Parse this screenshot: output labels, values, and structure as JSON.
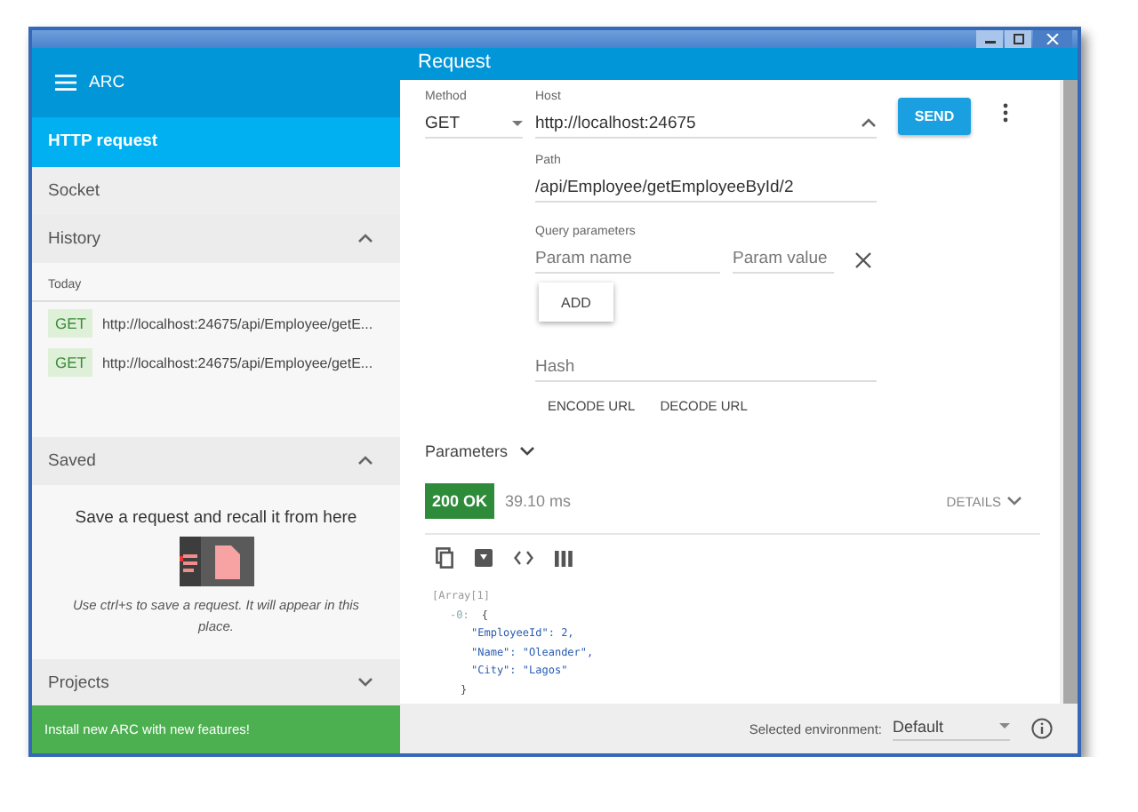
{
  "sidebar": {
    "title": "ARC",
    "nav": [
      {
        "label": "HTTP request",
        "selected": true
      },
      {
        "label": "Socket",
        "selected": false
      }
    ],
    "history": {
      "label": "History",
      "expanded": true,
      "groups": [
        {
          "label": "Today",
          "items": [
            {
              "method": "GET",
              "url": "http://localhost:24675/api/Employee/getE..."
            },
            {
              "method": "GET",
              "url": "http://localhost:24675/api/Employee/getE..."
            }
          ]
        }
      ]
    },
    "saved": {
      "label": "Saved",
      "expanded": true,
      "message": "Save a request and recall it from here",
      "hint": "Use ctrl+s to save a request. It will appear in this place."
    },
    "projects": {
      "label": "Projects",
      "expanded": false
    },
    "banner": "Install new ARC with new features!"
  },
  "request": {
    "title": "Request",
    "method": {
      "label": "Method",
      "value": "GET"
    },
    "host": {
      "label": "Host",
      "value": "http://localhost:24675"
    },
    "send": "SEND",
    "path": {
      "label": "Path",
      "value": "/api/Employee/getEmployeeById/2"
    },
    "query": {
      "label": "Query parameters",
      "name_placeholder": "Param name",
      "value_placeholder": "Param value",
      "add": "ADD"
    },
    "hash": {
      "placeholder": "Hash"
    },
    "url_buttons": [
      "ENCODE URL",
      "DECODE URL"
    ],
    "parameters": {
      "label": "Parameters",
      "expanded": false
    }
  },
  "response": {
    "status": "200 OK",
    "time": "39.10 ms",
    "details": {
      "label": "DETAILS",
      "expanded": false
    },
    "body": {
      "label": "[Array[1]",
      "items": [
        {
          "key": "-0:",
          "open": "{",
          "fields": [
            "\"EmployeeId\": 2,",
            "\"Name\": \"Oleander\",",
            "\"City\": \"Lagos\""
          ],
          "close": "}"
        }
      ]
    }
  },
  "footer": {
    "env_label": "Selected environment:",
    "env_value": "Default"
  }
}
